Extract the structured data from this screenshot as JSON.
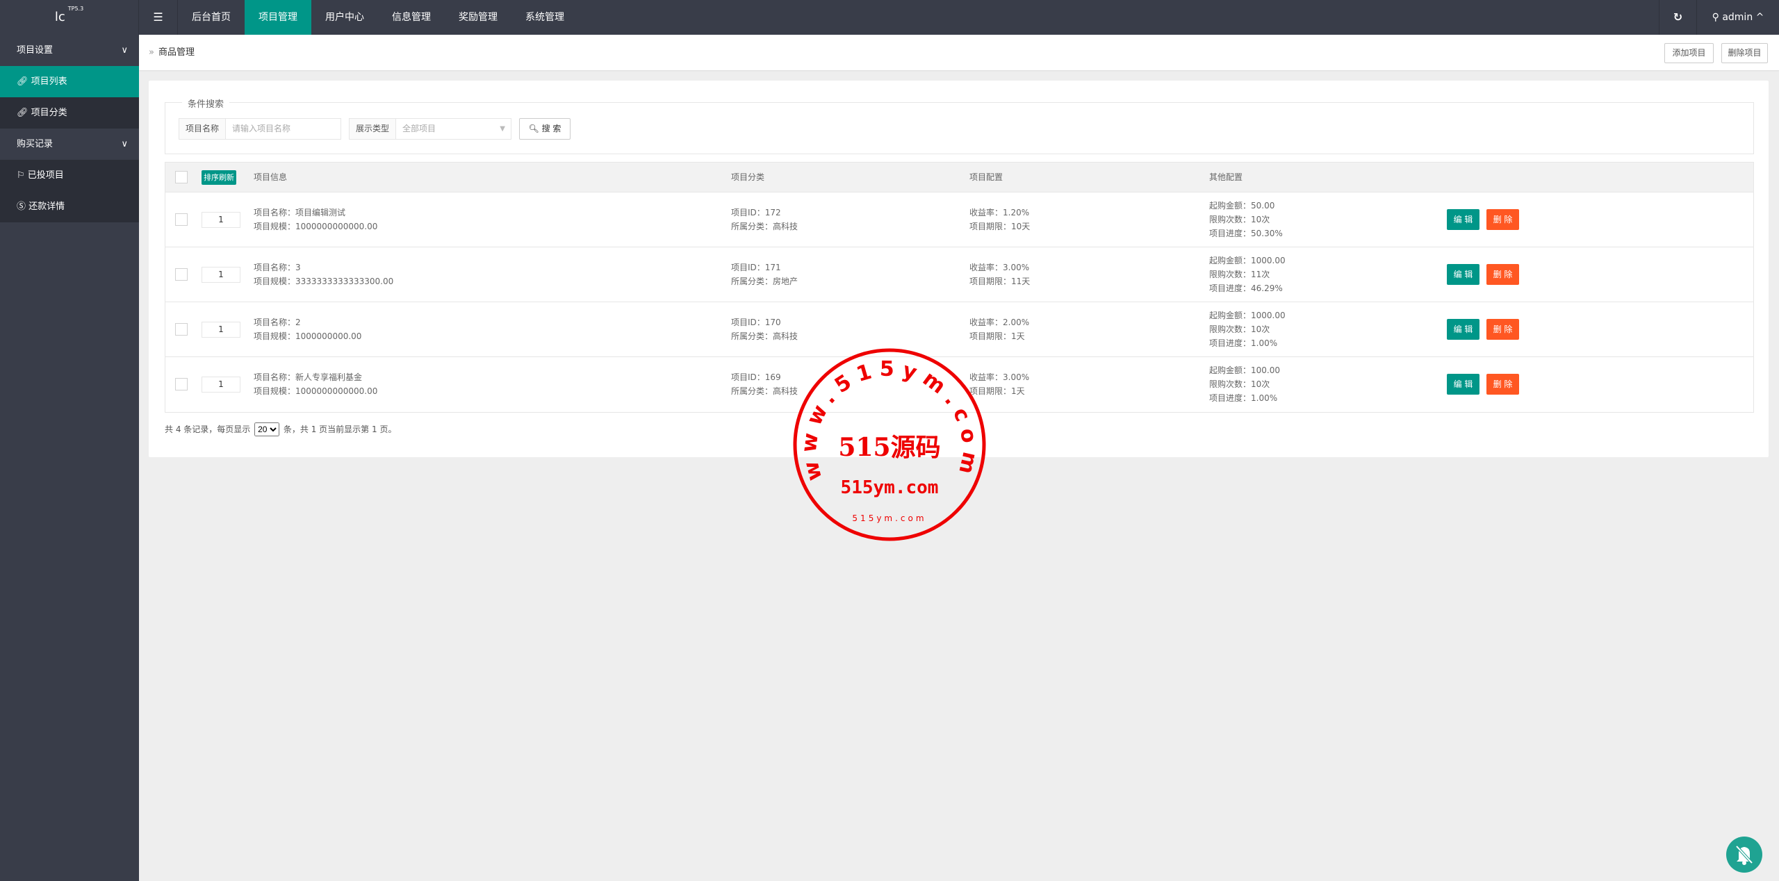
{
  "header": {
    "logo": "lc",
    "version": "TP5.3",
    "menu_icon": "hamburger-icon",
    "nav": [
      {
        "label": "后台首页",
        "active": false
      },
      {
        "label": "项目管理",
        "active": true
      },
      {
        "label": "用户中心",
        "active": false
      },
      {
        "label": "信息管理",
        "active": false
      },
      {
        "label": "奖励管理",
        "active": false
      },
      {
        "label": "系统管理",
        "active": false
      }
    ],
    "refresh_icon": "refresh-icon",
    "user": "admin"
  },
  "sidebar": {
    "groups": [
      {
        "label": "项目设置",
        "items": [
          {
            "label": "项目列表",
            "icon": "link-icon",
            "active": true
          },
          {
            "label": "项目分类",
            "icon": "link-icon",
            "active": false
          }
        ]
      },
      {
        "label": "购买记录",
        "items": [
          {
            "label": "已投项目",
            "icon": "flag-icon",
            "active": false
          },
          {
            "label": "还款详情",
            "icon": "dollar-icon",
            "active": false
          }
        ]
      }
    ]
  },
  "breadcrumb": {
    "title": "商品管理",
    "add_label": "添加项目",
    "delete_label": "删除项目"
  },
  "search": {
    "legend": "条件搜索",
    "name_label": "项目名称",
    "name_placeholder": "请输入项目名称",
    "type_label": "展示类型",
    "type_value": "全部项目",
    "search_label": "搜 索"
  },
  "table": {
    "sort_refresh": "排序刷新",
    "columns": [
      "项目信息",
      "项目分类",
      "项目配置",
      "其他配置"
    ],
    "edit_label": "编 辑",
    "delete_label": "删 除",
    "rows": [
      {
        "sort": "1",
        "name": "项目名称：项目编辑测试",
        "scale": "项目规模：1000000000000.00",
        "id": "项目ID：172",
        "category": "所属分类：高科技",
        "rate": "收益率：1.20%",
        "term": "项目期限：10天",
        "min": "起购金额：50.00",
        "limit": "限购次数：10次",
        "progress": "项目进度：50.30%"
      },
      {
        "sort": "1",
        "name": "项目名称：3",
        "scale": "项目规模：3333333333333300.00",
        "id": "项目ID：171",
        "category": "所属分类：房地产",
        "rate": "收益率：3.00%",
        "term": "项目期限：11天",
        "min": "起购金额：1000.00",
        "limit": "限购次数：11次",
        "progress": "项目进度：46.29%"
      },
      {
        "sort": "1",
        "name": "项目名称：2",
        "scale": "项目规模：1000000000.00",
        "id": "项目ID：170",
        "category": "所属分类：高科技",
        "rate": "收益率：2.00%",
        "term": "项目期限：1天",
        "min": "起购金额：1000.00",
        "limit": "限购次数：10次",
        "progress": "项目进度：1.00%"
      },
      {
        "sort": "1",
        "name": "项目名称：新人专享福利基金",
        "scale": "项目规模：1000000000000.00",
        "id": "项目ID：169",
        "category": "所属分类：高科技",
        "rate": "收益率：3.00%",
        "term": "项目期限：1天",
        "min": "起购金额：100.00",
        "limit": "限购次数：10次",
        "progress": "项目进度：1.00%"
      }
    ]
  },
  "pager": {
    "prefix": "共 4 条记录，每页显示",
    "page_size": "20",
    "suffix": "条，共 1 页当前显示第 1 页。"
  },
  "watermark": {
    "arc_text": "www.515ym.com",
    "center": "515源码",
    "domain": "515ym.com",
    "small": "515ym.com"
  },
  "colors": {
    "primary": "#009688",
    "danger": "#ff5722",
    "header": "#393d49",
    "stamp": "#ee0000"
  },
  "floating": {
    "icon": "bell-off-icon"
  }
}
